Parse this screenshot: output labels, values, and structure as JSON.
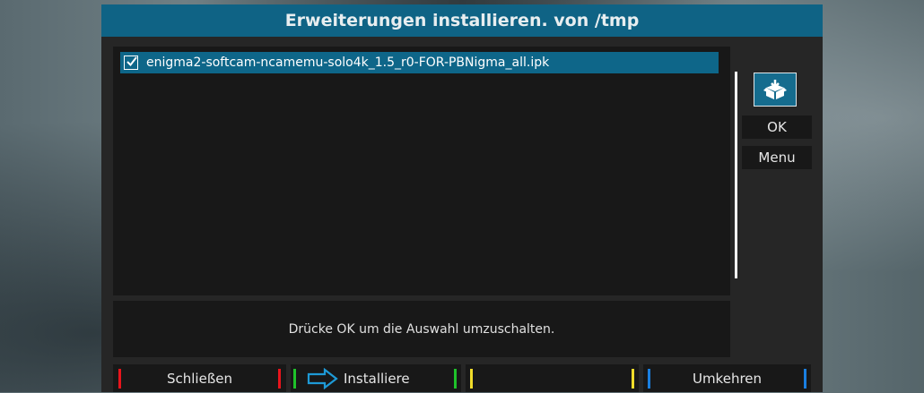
{
  "window": {
    "title": "Erweiterungen installieren. von /tmp"
  },
  "package_list": {
    "items": [
      {
        "label": "enigma2-softcam-ncamemu-solo4k_1.5_r0-FOR-PBNigma_all.ipk",
        "checked": true
      }
    ]
  },
  "side_panel": {
    "icon": "package-box-icon",
    "ok_label": "OK",
    "menu_label": "Menu"
  },
  "hint": {
    "text": "Drücke OK um die Auswahl umzuschalten."
  },
  "color_buttons": {
    "red": {
      "label": "Schließen",
      "color": "#e8141c"
    },
    "green": {
      "label": "Installiere",
      "color": "#1fc22a",
      "icon": "arrow-right-icon",
      "icon_color": "#1e9ad6"
    },
    "yellow": {
      "label": "",
      "color": "#f0dc2a"
    },
    "blue": {
      "label": "Umkehren",
      "color": "#1a7fe0"
    }
  },
  "colors": {
    "title_bar": "#0f6385",
    "selection": "#0e6689",
    "panel": "#181818"
  }
}
